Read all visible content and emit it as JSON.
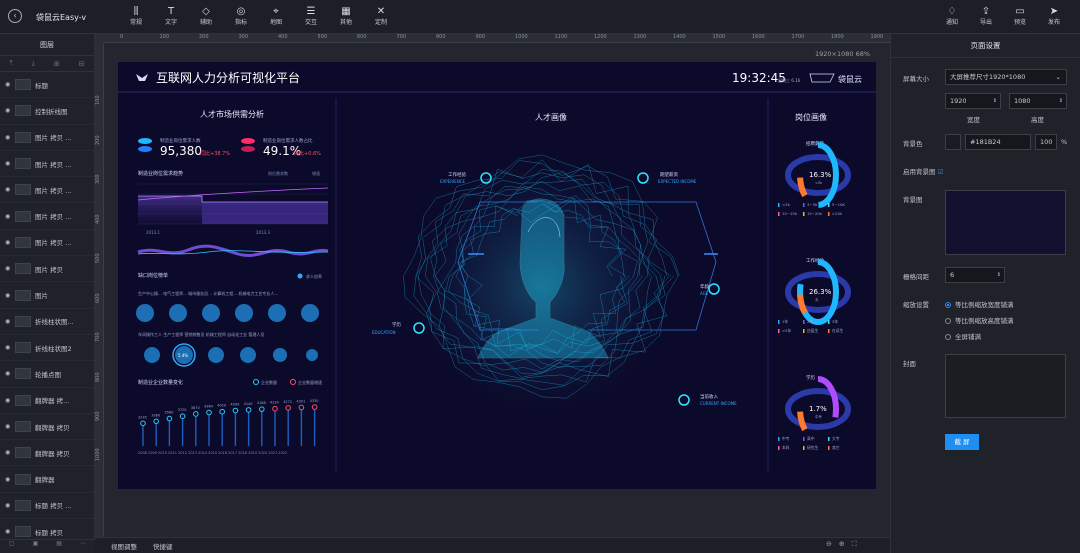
{
  "app": {
    "name": "袋鼠云Easy-v"
  },
  "toolbar": {
    "tools": [
      {
        "label": "常规",
        "icon": "chart-icon"
      },
      {
        "label": "文字",
        "icon": "text-icon"
      },
      {
        "label": "辅助",
        "icon": "shapes-icon"
      },
      {
        "label": "指标",
        "icon": "target-icon"
      },
      {
        "label": "地图",
        "icon": "map-pin-icon"
      },
      {
        "label": "交互",
        "icon": "sliders-icon"
      },
      {
        "label": "其他",
        "icon": "grid-icon"
      },
      {
        "label": "定制",
        "icon": "cross-icon"
      }
    ],
    "actions": [
      {
        "label": "通知",
        "icon": "bell-icon"
      },
      {
        "label": "导出",
        "icon": "export-icon"
      },
      {
        "label": "预览",
        "icon": "preview-icon"
      },
      {
        "label": "发布",
        "icon": "send-icon"
      }
    ]
  },
  "layers": {
    "title": "图层",
    "items": [
      "标题",
      "控制折线图",
      "图片 拷贝 ...",
      "图片 拷贝 ...",
      "图片 拷贝 ...",
      "图片 拷贝 ...",
      "图片 拷贝 ...",
      "图片 拷贝",
      "图片",
      "折线柱状图...",
      "折线柱状图2",
      "轮播点图",
      "翻牌器 拷...",
      "翻牌器 拷贝",
      "翻牌器 拷贝",
      "翻牌器",
      "标题 拷贝 ...",
      "标题 拷贝"
    ]
  },
  "ruler": {
    "top": [
      "0",
      "100",
      "200",
      "300",
      "400",
      "500",
      "600",
      "700",
      "800",
      "900",
      "1000",
      "1100",
      "1200",
      "1300",
      "1400",
      "1500",
      "1600",
      "1700",
      "1800",
      "1900"
    ],
    "left": [
      "100",
      "200",
      "300",
      "400",
      "500",
      "600",
      "700",
      "800",
      "900",
      "1000"
    ]
  },
  "stage": {
    "size_info": "1920×1080 68%",
    "bottom_left": "视图调整",
    "bottom_mid": "快捷键"
  },
  "dashboard": {
    "title": "互联网人力分析可视化平台",
    "time": "19:32:45",
    "date": "星期三 6.16",
    "brand": "袋鼠云",
    "sec_left": "人才市场供需分析",
    "sec_mid": "人才画像",
    "sec_right": "岗位画像",
    "kpi1": {
      "label": "制造业岗位需求人数",
      "value": "95,380",
      "delta": "同比+38.7%"
    },
    "kpi2": {
      "label": "制造业岗位需求人数占比",
      "value": "49.1%",
      "delta": "同比+0.6%"
    },
    "trend_title": "制造业岗位需求趋势",
    "trend_legend": [
      "岗位需求数",
      "增速"
    ],
    "gap_title": "缺口岗位榜单",
    "gap_legend": "求人倍率",
    "gap_row1": "生产中心操...  电气工程师...  城市服务员...  计算机工程...  机械电力工艺专业人...",
    "gap_row2": "车间操作工人  生产工程师  营销销售员  机械工程师  自动化工业  管理人员",
    "bubble_label": "5.4%",
    "ent_title": "制造业企业数量变化",
    "ent_legend": [
      "企业数量",
      "企业数量增速"
    ],
    "ent_values": [
      "3245",
      "3380",
      "3560",
      "3720",
      "3870",
      "3964",
      "4020",
      "4099",
      "4140",
      "4188",
      "4220",
      "4271",
      "4301",
      "4330"
    ],
    "ent_years": "2008 2009 2010 2011 2012 2013 2014 2015 2016 2017 2018 2019 2020 2021 2022",
    "nodes": {
      "exp": "工作经验",
      "exp_en": "EXPERIENCE",
      "inc": "期望薪资",
      "inc_en": "EXPECTED INCOME",
      "age": "年龄",
      "age_en": "AGE",
      "edu": "学历",
      "edu_en": "EDUCATION",
      "cur": "当前收入",
      "cur_en": "CURRENT INCOME"
    },
    "ring1": {
      "title": "招聘薪资",
      "value": "16.3%",
      "sub": "<3k",
      "legend": [
        "<3k",
        "3~5K",
        "5~10K",
        "10~15k",
        "15~20k",
        ">20k"
      ],
      "pct": 0.163
    },
    "ring2": {
      "title": "工作经验",
      "value": "26.3%",
      "sub": "无",
      "legend": [
        "1年",
        "2年",
        "3年",
        ">5年",
        "应届生",
        "在读生"
      ],
      "pct": 0.263
    },
    "ring3": {
      "title": "学历",
      "value": "1.7%",
      "sub": "中专",
      "legend": [
        "中专",
        "高中",
        "大专",
        "本科",
        "研究生",
        "其它"
      ],
      "pct": 0.017
    }
  },
  "props": {
    "title": "页面设置",
    "screen_label": "屏幕大小",
    "screen_value": "大屏推荐尺寸1920*1080",
    "width": "1920",
    "height": "1080",
    "width_label": "宽度",
    "height_label": "高度",
    "bg_label": "背景色",
    "bg_value": "#181B24",
    "opacity": "100",
    "percent": "%",
    "bgimg_enable": "启用背景图",
    "bgimg_label": "背景图",
    "grid_label": "栅格间距",
    "grid_value": "6",
    "scale_label": "缩放设置",
    "scale_opts": [
      "等比例缩放宽度铺满",
      "等比例缩放高度铺满",
      "全屏铺满"
    ],
    "cover_label": "封面",
    "save": "截 屏"
  },
  "colors": {
    "accent": "#1f8ef1",
    "canvas": "#0c0a2a",
    "cyan": "#2ee6ff"
  }
}
